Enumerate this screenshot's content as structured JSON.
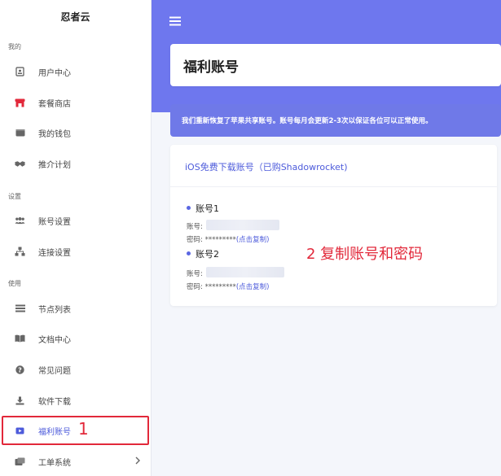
{
  "sidebar": {
    "brand": "忍者云",
    "sections": {
      "mine": "我的",
      "settings": "设置",
      "usage": "使用"
    },
    "items": [
      {
        "label": "用户中心"
      },
      {
        "label": "套餐商店"
      },
      {
        "label": "我的钱包"
      },
      {
        "label": "推介计划"
      },
      {
        "label": "账号设置"
      },
      {
        "label": "连接设置"
      },
      {
        "label": "节点列表"
      },
      {
        "label": "文档中心"
      },
      {
        "label": "常见问题"
      },
      {
        "label": "软件下载"
      },
      {
        "label": "福利账号"
      },
      {
        "label": "工单系统"
      }
    ],
    "active_index": 10
  },
  "annotations": {
    "step1": "1",
    "step2": "2 复制账号和密码"
  },
  "main": {
    "page_title": "福利账号",
    "notice": "我们重新恢复了苹果共享账号。账号每月会更新2-3次以保证各位可以正常使用。",
    "card_title": "iOS免费下载账号（已购Shadowrocket)",
    "accounts": [
      {
        "name": "账号1",
        "account_label": "账号:",
        "password_label": "密码:",
        "password_mask": "*********",
        "copy_label": "(点击复制)"
      },
      {
        "name": "账号2",
        "account_label": "账号:",
        "password_label": "密码:",
        "password_mask": "*********",
        "copy_label": "(点击复制)"
      }
    ]
  },
  "colors": {
    "accent": "#6e77ee",
    "link": "#4d5bdb",
    "highlight": "#e2283a"
  }
}
